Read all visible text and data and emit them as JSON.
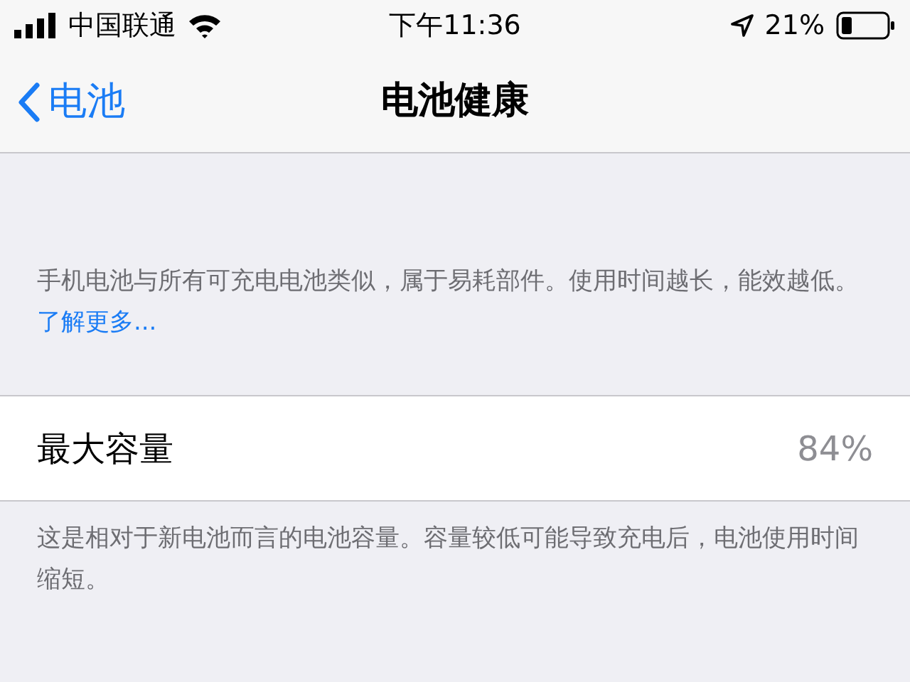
{
  "status_bar": {
    "carrier": "中国联通",
    "time": "下午11:36",
    "battery_percent": "21%"
  },
  "nav": {
    "back_label": "电池",
    "title": "电池健康"
  },
  "intro": {
    "text": "手机电池与所有可充电电池类似，属于易耗部件。使用时间越长，能效越低。",
    "link": "了解更多..."
  },
  "capacity": {
    "label": "最大容量",
    "value": "84%"
  },
  "footer": "这是相对于新电池而言的电池容量。容量较低可能导致充电后，电池使用时间缩短。"
}
